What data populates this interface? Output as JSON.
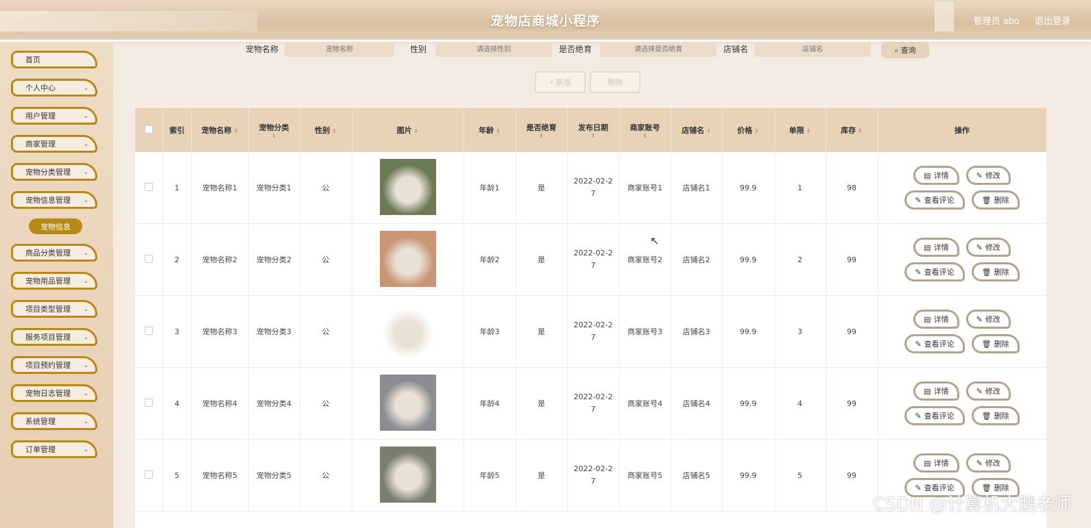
{
  "header": {
    "title": "宠物店商城小程序",
    "user_label": "管理员 abo",
    "logout": "退出登录"
  },
  "sidebar": {
    "items": [
      {
        "label": "首页",
        "chevron": false
      },
      {
        "label": "个人中心",
        "chevron": true
      },
      {
        "label": "用户管理",
        "chevron": true
      },
      {
        "label": "商家管理",
        "chevron": true
      },
      {
        "label": "宠物分类管理",
        "chevron": true
      },
      {
        "label": "宠物信息管理",
        "chevron": true
      },
      {
        "label": "商品分类管理",
        "chevron": true
      },
      {
        "label": "宠物用品管理",
        "chevron": true
      },
      {
        "label": "项目类型管理",
        "chevron": true
      },
      {
        "label": "服务项目管理",
        "chevron": true
      },
      {
        "label": "项目预约管理",
        "chevron": true
      },
      {
        "label": "宠物日志管理",
        "chevron": true
      },
      {
        "label": "系统管理",
        "chevron": true
      },
      {
        "label": "订单管理",
        "chevron": true
      }
    ],
    "submenu_active": "宠物信息"
  },
  "search": {
    "name_label": "宠物名称",
    "name_placeholder": "宠物名称",
    "gender_label": "性别",
    "gender_placeholder": "请选择性别",
    "neutered_label": "是否绝育",
    "neutered_placeholder": "请选择是否绝育",
    "shop_label": "店铺名",
    "shop_placeholder": "店铺名",
    "query_button": "查询"
  },
  "actions": {
    "add": "+ 新增",
    "delete": "删除"
  },
  "table": {
    "columns": [
      "索引",
      "宠物名称",
      "宠物分类",
      "性别",
      "图片",
      "年龄",
      "是否绝育",
      "发布日期",
      "商家账号",
      "店铺名",
      "价格",
      "单限",
      "库存",
      "操作"
    ],
    "rows": [
      {
        "index": "1",
        "name": "宠物名称1",
        "category": "宠物分类1",
        "gender": "公",
        "age": "年龄1",
        "neutered": "是",
        "date": "2022-02-27",
        "merchant": "商家账号1",
        "shop": "店铺名1",
        "price": "99.9",
        "limit": "1",
        "stock": "98",
        "image": "dog-bulldog",
        "color": "#6b7a55"
      },
      {
        "index": "2",
        "name": "宠物名称2",
        "category": "宠物分类2",
        "gender": "公",
        "age": "年龄2",
        "neutered": "是",
        "date": "2022-02-27",
        "merchant": "商家账号2",
        "shop": "店铺名2",
        "price": "99.9",
        "limit": "2",
        "stock": "99",
        "image": "cat-orange",
        "color": "#c99573"
      },
      {
        "index": "3",
        "name": "宠物名称3",
        "category": "宠物分类3",
        "gender": "公",
        "age": "年龄3",
        "neutered": "是",
        "date": "2022-02-27",
        "merchant": "商家账号3",
        "shop": "店铺名3",
        "price": "99.9",
        "limit": "3",
        "stock": "99",
        "image": "dog-poodle",
        "color": "#ffffff"
      },
      {
        "index": "4",
        "name": "宠物名称4",
        "category": "宠物分类4",
        "gender": "公",
        "age": "年龄4",
        "neutered": "是",
        "date": "2022-02-27",
        "merchant": "商家账号4",
        "shop": "店铺名4",
        "price": "99.9",
        "limit": "4",
        "stock": "99",
        "image": "cat-grey",
        "color": "#8c8d91"
      },
      {
        "index": "5",
        "name": "宠物名称5",
        "category": "宠物分类5",
        "gender": "公",
        "age": "年龄5",
        "neutered": "是",
        "date": "2022-02-27",
        "merchant": "商家账号5",
        "shop": "店铺名5",
        "price": "99.9",
        "limit": "5",
        "stock": "99",
        "image": "dog-white",
        "color": "#7a8070"
      }
    ],
    "op_labels": {
      "detail": "详情",
      "edit": "修改",
      "comments": "查看评论",
      "delete": "删除"
    }
  },
  "watermark": "CSDN @计算机大鹅老师"
}
